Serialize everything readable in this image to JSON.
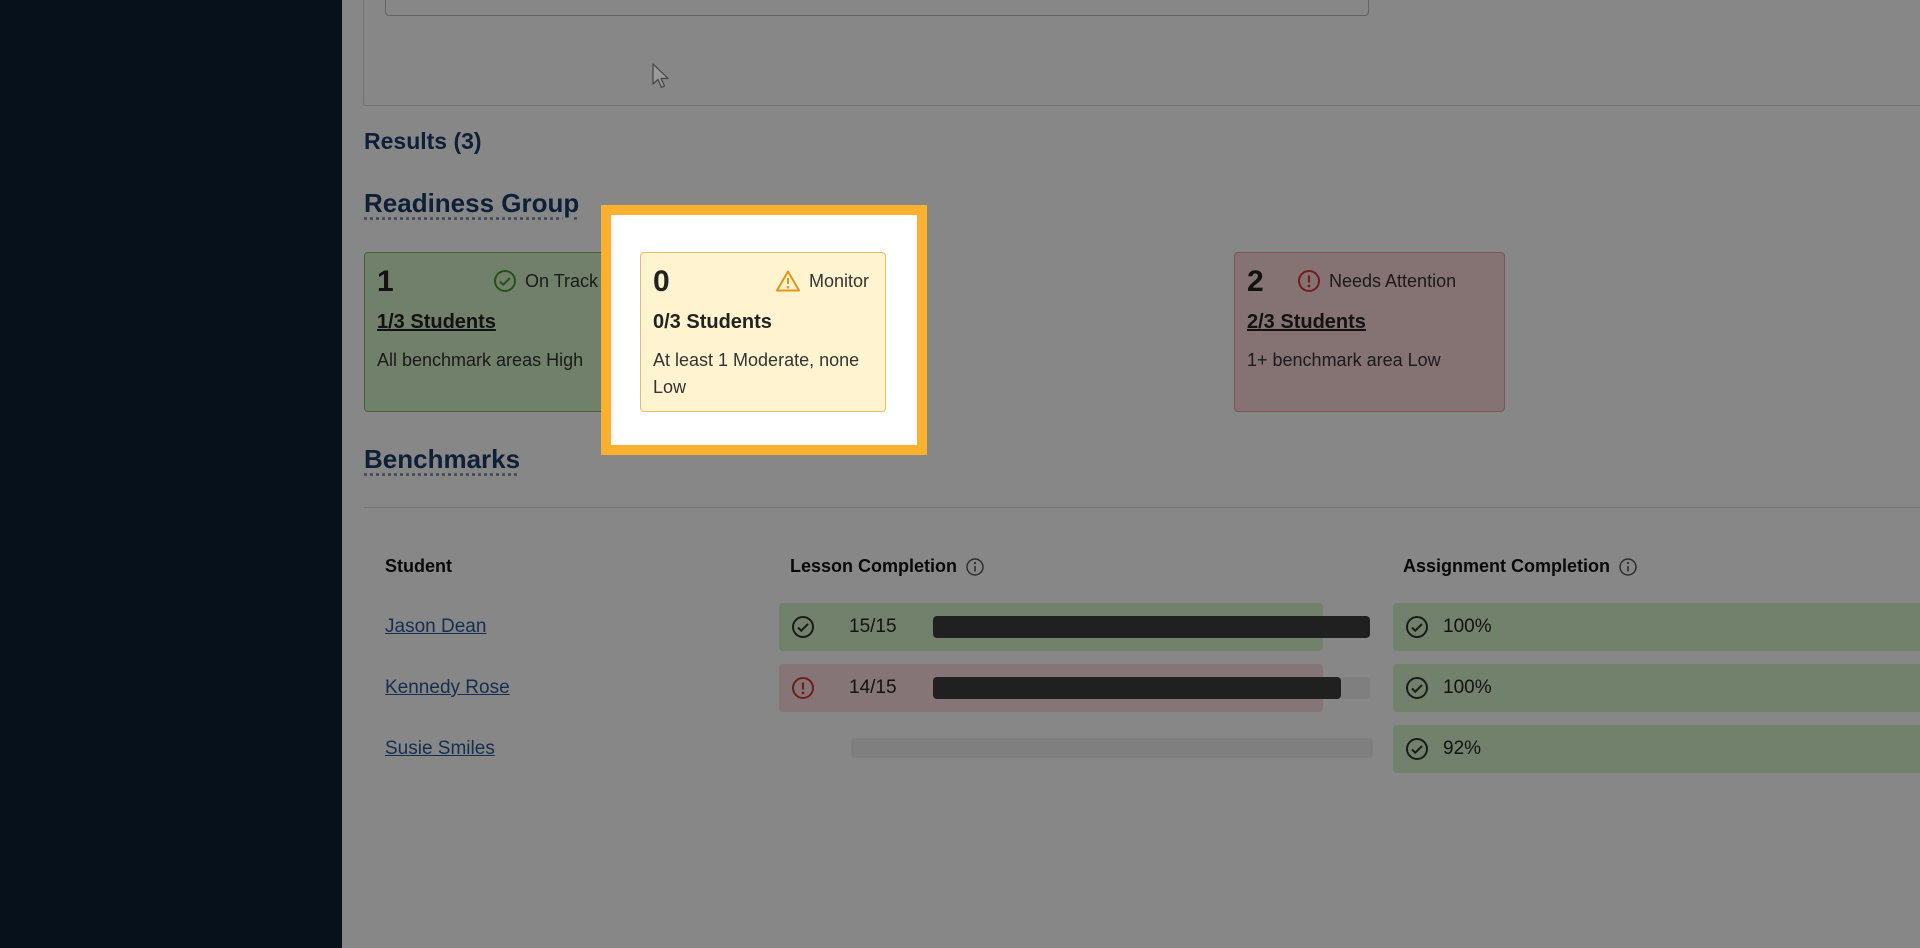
{
  "results": {
    "label": "Results (3)"
  },
  "readiness": {
    "title": "Readiness Group",
    "cards": [
      {
        "count": "1",
        "status": "On Track",
        "students": "1/3 Students",
        "description": "All benchmark areas High",
        "color": "#d6f1c9"
      },
      {
        "count": "0",
        "status": "Monitor",
        "students": "0/3 Students",
        "description": "At least 1 Moderate, none Low",
        "color": "#fff4cf"
      },
      {
        "count": "2",
        "status": "Needs Attention",
        "students": "2/3 Students",
        "description": "1+ benchmark area Low",
        "color": "#fbd9dc"
      }
    ]
  },
  "benchmarks": {
    "title": "Benchmarks",
    "columns": {
      "student": "Student",
      "lesson": "Lesson Completion",
      "assignment": "Assignment Completion"
    },
    "rows": [
      {
        "name": "Jason Dean",
        "lesson_value": "15/15",
        "lesson_fraction": 1.0,
        "lesson_status": "on-track",
        "assignment": "100%"
      },
      {
        "name": "Kennedy Rose",
        "lesson_value": "14/15",
        "lesson_fraction": 0.933,
        "lesson_status": "needs-attention",
        "assignment": "100%"
      },
      {
        "name": "Susie Smiles",
        "lesson_value": "",
        "lesson_fraction": 0,
        "lesson_status": "none",
        "assignment": "92%"
      }
    ]
  },
  "colors": {
    "highlight": "#fbb12e",
    "sidebar": "#0c2033",
    "on_track": "#4a9a2c",
    "monitor": "#e0961b",
    "needs_attention": "#d23a3a"
  }
}
